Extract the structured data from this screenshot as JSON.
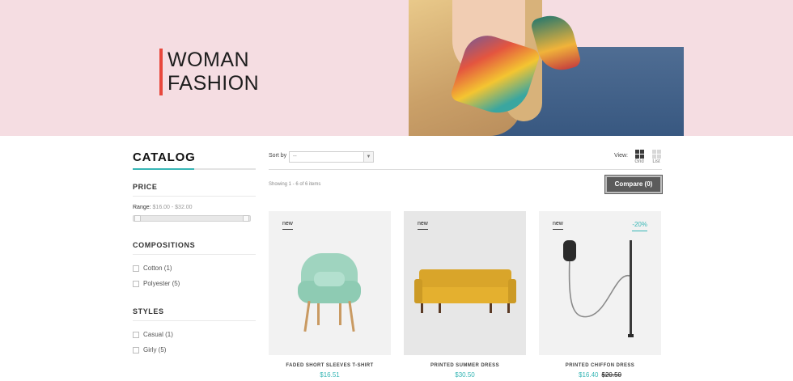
{
  "banner": {
    "title_line1": "WOMAN",
    "title_line2": "FASHION",
    "accent_color": "#e8473c",
    "background_color": "#f5dde2"
  },
  "sidebar": {
    "catalog_title": "CATALOG",
    "price": {
      "title": "PRICE",
      "range_label": "Range:",
      "range_value": "$16.00 - $32.00"
    },
    "compositions": {
      "title": "COMPOSITIONS",
      "items": [
        {
          "label": "Cotton (1)",
          "checked": false
        },
        {
          "label": "Polyester (5)",
          "checked": false
        }
      ]
    },
    "styles": {
      "title": "STYLES",
      "items": [
        {
          "label": "Casual (1)",
          "checked": false
        },
        {
          "label": "Girly (5)",
          "checked": false
        }
      ]
    }
  },
  "toolbar": {
    "sort_label": "Sort by",
    "sort_value": "--",
    "view_label": "View:",
    "view_grid": "Grid",
    "view_list": "List",
    "active_view": "grid"
  },
  "listing": {
    "showing_text": "Showing 1 - 6 of 6 items",
    "compare_label": "Compare (0)"
  },
  "products": [
    {
      "name": "FADED SHORT SLEEVES T-SHIRT",
      "price": "$16.51",
      "old_price": "",
      "badge": "new",
      "discount": "",
      "image": "mint-armchair"
    },
    {
      "name": "PRINTED SUMMER DRESS",
      "price": "$30.50",
      "old_price": "",
      "badge": "new",
      "discount": "",
      "image": "yellow-sofa"
    },
    {
      "name": "PRINTED CHIFFON DRESS",
      "price": "$16.40",
      "old_price": "$20.50",
      "badge": "new",
      "discount": "-20%",
      "image": "floor-lamp"
    }
  ],
  "colors": {
    "accent": "#37b6b5",
    "compare_button": "#5b5b5b"
  }
}
